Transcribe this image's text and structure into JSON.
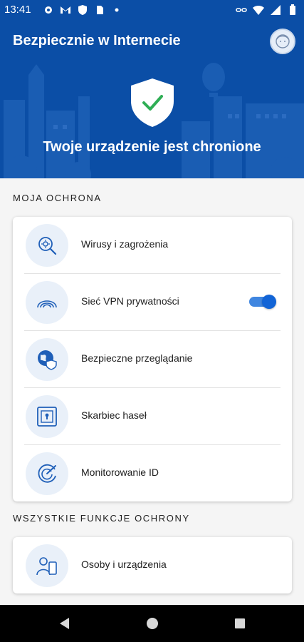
{
  "status_bar": {
    "time": "13:41",
    "left_icons": [
      "gear-icon",
      "gmail-icon",
      "shield-icon",
      "sim-icon",
      "dot-icon"
    ],
    "right_icons": [
      "link-icon",
      "wifi-icon",
      "signal-icon",
      "battery-icon"
    ]
  },
  "header": {
    "title": "Bezpiecznie w Internecie",
    "status_text": "Twoje urządzenie jest chronione",
    "status_icon": "shield-check-icon",
    "brand_color": "#0b4ea6"
  },
  "my_protection": {
    "section_title": "MOJA OCHRONA",
    "items": [
      {
        "label": "Wirusy i zagrożenia",
        "icon": "virus-search-icon"
      },
      {
        "label": "Sieć VPN prywatności",
        "icon": "vpn-signal-icon",
        "toggle_on": true
      },
      {
        "label": "Bezpieczne przeglądanie",
        "icon": "globe-shield-icon"
      },
      {
        "label": "Skarbiec haseł",
        "icon": "vault-icon"
      },
      {
        "label": "Monitorowanie ID",
        "icon": "radar-icon"
      }
    ]
  },
  "all_features": {
    "section_title": "WSZYSTKIE FUNKCJE OCHRONY",
    "items": [
      {
        "label": "Osoby i urządzenia",
        "icon": "people-devices-icon"
      }
    ]
  },
  "nav": {
    "icons": [
      "back-icon",
      "home-icon",
      "recents-icon"
    ]
  }
}
